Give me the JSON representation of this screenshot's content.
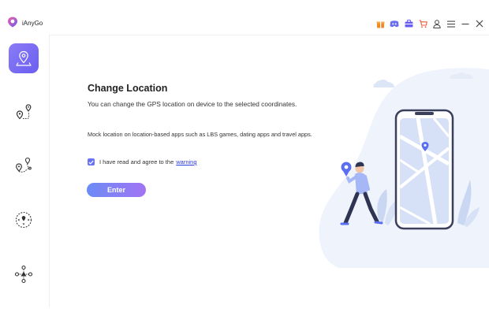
{
  "app": {
    "name": "iAnyGo"
  },
  "titlebar": {
    "icons": [
      "gift-icon",
      "discord-icon",
      "toolbox-icon",
      "cart-icon",
      "user-icon",
      "menu-icon",
      "minimize-icon",
      "close-icon"
    ]
  },
  "sidebar": {
    "items": [
      {
        "name": "change-location",
        "icon": "location-pin-map-icon",
        "active": true
      },
      {
        "name": "single-spot-movement",
        "icon": "two-spot-route-icon",
        "active": false
      },
      {
        "name": "multi-spot-movement",
        "icon": "multi-spot-route-icon",
        "active": false
      },
      {
        "name": "joystick-movement",
        "icon": "joystick-icon",
        "active": false
      },
      {
        "name": "game-mode",
        "icon": "gamepad-icon",
        "active": false
      }
    ]
  },
  "main": {
    "title": "Change Location",
    "description": "You can change the GPS location on device to the selected coordinates.",
    "note": "Mock location on location-based apps such as LBS games, dating apps and travel apps.",
    "agree": {
      "checked": true,
      "text": "I have read and agree to the",
      "link": "warning"
    },
    "enter_label": "Enter"
  },
  "colors": {
    "accent": "#7a6ff3",
    "link": "#2a3ad8",
    "titlebar_icons": "#f08a24"
  }
}
